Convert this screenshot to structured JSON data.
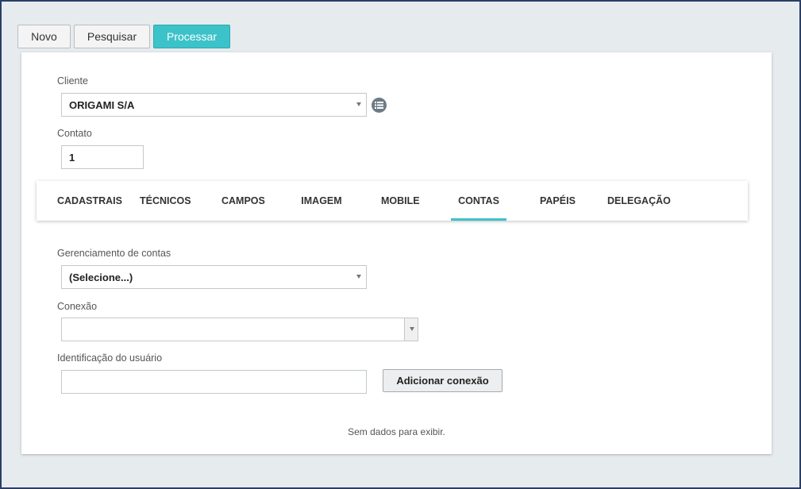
{
  "toolbar": {
    "novo_label": "Novo",
    "pesquisar_label": "Pesquisar",
    "processar_label": "Processar"
  },
  "form": {
    "cliente_label": "Cliente",
    "cliente_value": "ORIGAMI S/A",
    "contato_label": "Contato",
    "contato_value": "1"
  },
  "tabs": [
    {
      "label": "CADASTRAIS"
    },
    {
      "label": "TÉCNICOS"
    },
    {
      "label": "CAMPOS"
    },
    {
      "label": "IMAGEM"
    },
    {
      "label": "MOBILE"
    },
    {
      "label": "CONTAS",
      "active": true
    },
    {
      "label": "PAPÉIS"
    },
    {
      "label": "DELEGAÇÃO"
    }
  ],
  "contas": {
    "gerenciamento_label": "Gerenciamento de contas",
    "gerenciamento_value": "(Selecione...)",
    "conexao_label": "Conexão",
    "conexao_value": "",
    "identificacao_label": "Identificação do usuário",
    "identificacao_value": "",
    "add_button_label": "Adicionar conexão",
    "empty_text": "Sem dados para exibir."
  },
  "colors": {
    "accent": "#3cc2c9",
    "frame": "#2a3f66",
    "background": "#e6ebee"
  },
  "icons": {
    "list": "list-icon",
    "dropdown": "chevron-down-icon"
  }
}
